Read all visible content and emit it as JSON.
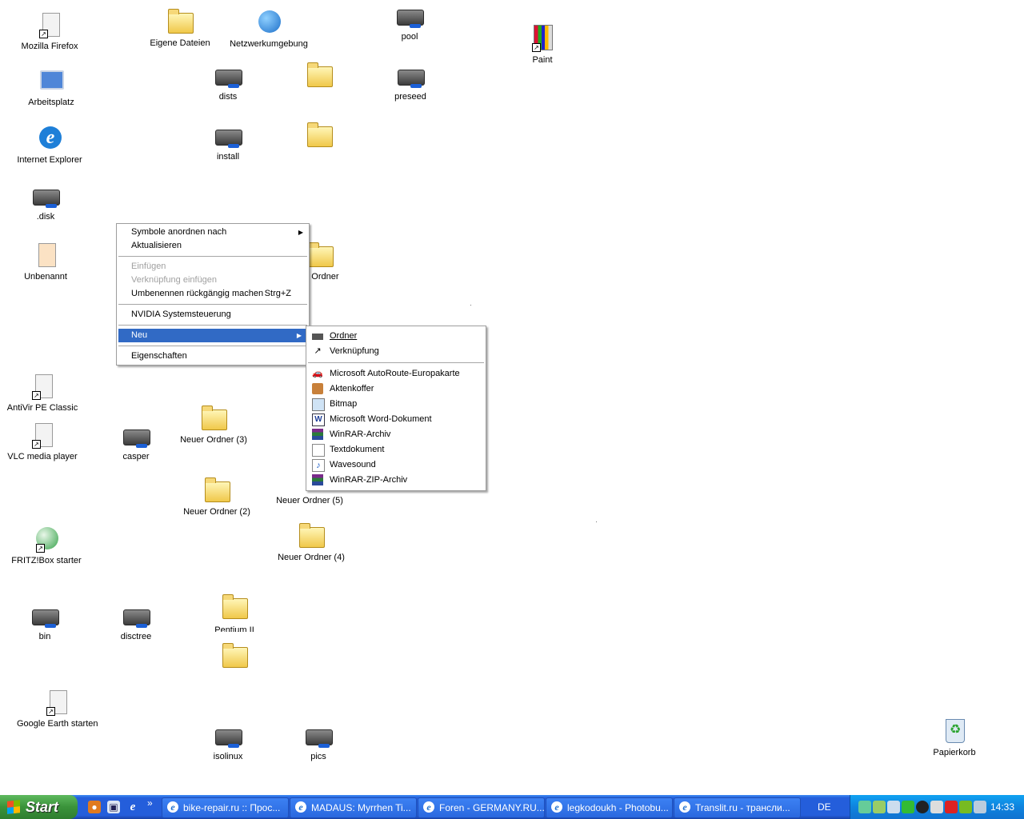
{
  "desktop": {
    "icons": {
      "mozilla_firefox": "Mozilla Firefox",
      "eigene_dateien": "Eigene Dateien",
      "netzwerkumgebung": "Netzwerkumgebung",
      "pool": "pool",
      "paint": "Paint",
      "arbeitsplatz": "Arbeitsplatz",
      "dists": "dists",
      "preseed": "preseed",
      "internet_explorer": "Internet Explorer",
      "install": "install",
      "disk": ".disk",
      "unbenannt": "Unbenannt",
      "neuer_ordner_partial": "er Ordner",
      "antivir": "AntiVir PE Classic",
      "vlc": "VLC media player",
      "casper": "casper",
      "neuer_ordner_3": "Neuer Ordner (3)",
      "neuer_ordner_2": "Neuer Ordner (2)",
      "neuer_ordner_5": "Neuer Ordner (5)",
      "fritzbox": "FRITZ!Box starter",
      "neuer_ordner_4": "Neuer Ordner (4)",
      "bin": "bin",
      "disctree": "disctree",
      "pentium": "Pentium II",
      "google_earth": "Google Earth starten",
      "isolinux": "isolinux",
      "pics": "pics",
      "papierkorb": "Papierkorb"
    }
  },
  "context_menu": {
    "items": [
      {
        "label": "Symbole anordnen nach",
        "submenu": true
      },
      {
        "label": "Aktualisieren"
      },
      {
        "label": "Einfügen",
        "disabled": true
      },
      {
        "label": "Verknüpfung einfügen",
        "disabled": true
      },
      {
        "label": "Umbenennen rückgängig machen",
        "accel": "Strg+Z"
      },
      {
        "label": "NVIDIA Systemsteuerung"
      },
      {
        "label": "Neu",
        "submenu": true,
        "selected": true
      },
      {
        "label": "Eigenschaften"
      }
    ]
  },
  "new_submenu": {
    "items": [
      {
        "label": "Ordner",
        "icon": "folder-icon"
      },
      {
        "label": "Verknüpfung",
        "icon": "shortcut-icon"
      },
      {
        "label": "Microsoft AutoRoute-Europakarte",
        "icon": "autoroute-icon"
      },
      {
        "label": "Aktenkoffer",
        "icon": "briefcase-icon"
      },
      {
        "label": "Bitmap",
        "icon": "bitmap-icon"
      },
      {
        "label": "Microsoft Word-Dokument",
        "icon": "word-icon"
      },
      {
        "label": "WinRAR-Archiv",
        "icon": "winrar-icon"
      },
      {
        "label": "Textdokument",
        "icon": "text-document-icon"
      },
      {
        "label": "Wavesound",
        "icon": "wavesound-icon"
      },
      {
        "label": "WinRAR-ZIP-Archiv",
        "icon": "winrar-zip-icon"
      }
    ]
  },
  "taskbar": {
    "start_label": "Start",
    "chevron": "»",
    "tasks": [
      {
        "label": "bike-repair.ru :: Прос..."
      },
      {
        "label": "MADAUS: Myrrhen Ti..."
      },
      {
        "label": "Foren - GERMANY.RU..."
      },
      {
        "label": "legkodoukh - Photobu..."
      },
      {
        "label": "Translit.ru - трансли..."
      }
    ],
    "language": "DE",
    "clock": "14:33"
  },
  "colors": {
    "taskbar_blue": "#245edb",
    "start_green": "#3a933a",
    "tray_blue": "#0f83de",
    "menu_highlight": "#316ac5"
  }
}
